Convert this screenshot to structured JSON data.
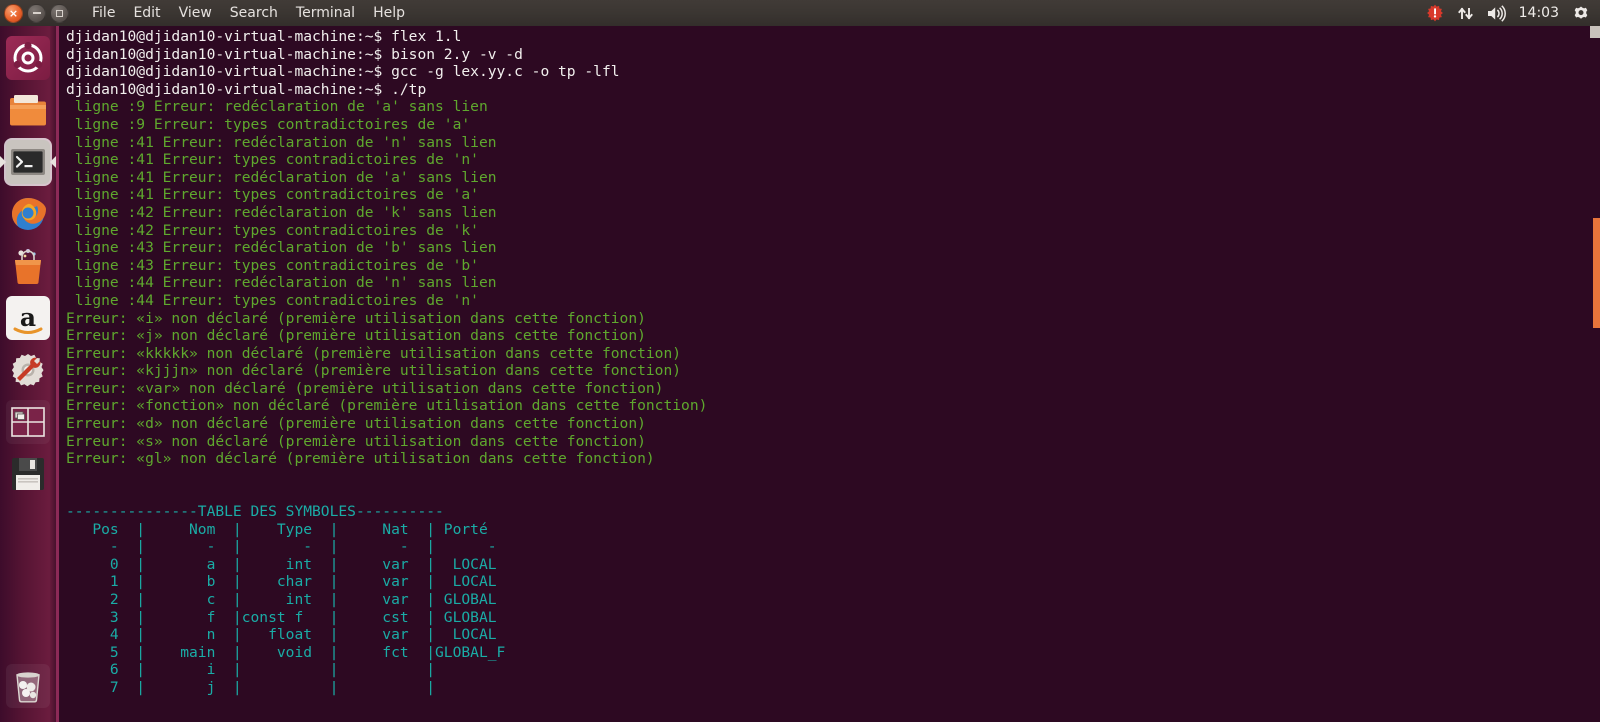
{
  "window": {
    "buttons": {
      "close": "×",
      "minimize": "−",
      "maximize": "□"
    },
    "menus": [
      "File",
      "Edit",
      "View",
      "Search",
      "Terminal",
      "Help"
    ]
  },
  "tray": {
    "icons": [
      "update-alert-icon",
      "network-icon",
      "volume-icon",
      "system-menu-icon"
    ],
    "clock": "14:03"
  },
  "launcher": {
    "items": [
      {
        "name": "ubuntu-dash",
        "label": "Dash home",
        "active": false
      },
      {
        "name": "files",
        "label": "Files",
        "active": false
      },
      {
        "name": "terminal",
        "label": "Terminal",
        "active": true
      },
      {
        "name": "firefox",
        "label": "Firefox Web Browser",
        "active": false
      },
      {
        "name": "software-center",
        "label": "Ubuntu Software Center",
        "active": false
      },
      {
        "name": "amazon",
        "label": "Amazon",
        "active": false
      },
      {
        "name": "system-settings",
        "label": "System Settings",
        "active": false
      },
      {
        "name": "workspace-switcher",
        "label": "Workspace Switcher",
        "active": false
      },
      {
        "name": "save-disk",
        "label": "Files & Devices",
        "active": false
      }
    ],
    "trash": {
      "name": "trash",
      "label": "Trash"
    }
  },
  "terminal": {
    "colors": {
      "background": "#2D0922",
      "prompt": "#F2F0EE",
      "error": "#5FA82E",
      "table": "#1AACA6",
      "border": "#8C2A57",
      "scrollbar": "#E8743B"
    },
    "prompt_user": "djidan10@djidan10-virtual-machine:~$",
    "lines": [
      {
        "style": "prompt",
        "text": "djidan10@djidan10-virtual-machine:~$ flex 1.l"
      },
      {
        "style": "prompt",
        "text": "djidan10@djidan10-virtual-machine:~$ bison 2.y -v -d"
      },
      {
        "style": "prompt",
        "text": "djidan10@djidan10-virtual-machine:~$ gcc -g lex.yy.c -o tp -lfl"
      },
      {
        "style": "prompt",
        "text": "djidan10@djidan10-virtual-machine:~$ ./tp"
      },
      {
        "style": "green",
        "text": " ligne :9 Erreur: redéclaration de 'a' sans lien"
      },
      {
        "style": "green",
        "text": " ligne :9 Erreur: types contradictoires de 'a'"
      },
      {
        "style": "green",
        "text": " ligne :41 Erreur: redéclaration de 'n' sans lien"
      },
      {
        "style": "green",
        "text": " ligne :41 Erreur: types contradictoires de 'n'"
      },
      {
        "style": "green",
        "text": " ligne :41 Erreur: redéclaration de 'a' sans lien"
      },
      {
        "style": "green",
        "text": " ligne :41 Erreur: types contradictoires de 'a'"
      },
      {
        "style": "green",
        "text": " ligne :42 Erreur: redéclaration de 'k' sans lien"
      },
      {
        "style": "green",
        "text": " ligne :42 Erreur: types contradictoires de 'k'"
      },
      {
        "style": "green",
        "text": " ligne :43 Erreur: redéclaration de 'b' sans lien"
      },
      {
        "style": "green",
        "text": " ligne :43 Erreur: types contradictoires de 'b'"
      },
      {
        "style": "green",
        "text": " ligne :44 Erreur: redéclaration de 'n' sans lien"
      },
      {
        "style": "green",
        "text": " ligne :44 Erreur: types contradictoires de 'n'"
      },
      {
        "style": "green",
        "text": "Erreur: «i» non déclaré (première utilisation dans cette fonction)"
      },
      {
        "style": "green",
        "text": "Erreur: «j» non déclaré (première utilisation dans cette fonction)"
      },
      {
        "style": "green",
        "text": "Erreur: «kkkkk» non déclaré (première utilisation dans cette fonction)"
      },
      {
        "style": "green",
        "text": "Erreur: «kjjjn» non déclaré (première utilisation dans cette fonction)"
      },
      {
        "style": "green",
        "text": "Erreur: «var» non déclaré (première utilisation dans cette fonction)"
      },
      {
        "style": "green",
        "text": "Erreur: «fonction» non déclaré (première utilisation dans cette fonction)"
      },
      {
        "style": "green",
        "text": "Erreur: «d» non déclaré (première utilisation dans cette fonction)"
      },
      {
        "style": "green",
        "text": "Erreur: «s» non déclaré (première utilisation dans cette fonction)"
      },
      {
        "style": "green",
        "text": "Erreur: «gl» non déclaré (première utilisation dans cette fonction)"
      },
      {
        "style": "blank",
        "text": " "
      },
      {
        "style": "blank",
        "text": " "
      },
      {
        "style": "cyan",
        "text": "---------------TABLE DES SYMBOLES----------"
      },
      {
        "style": "cyan",
        "text": "   Pos  |     Nom  |    Type  |     Nat  | Porté"
      },
      {
        "style": "cyan",
        "text": "     -  |       -  |       -  |       -  |      -"
      },
      {
        "style": "cyan",
        "text": "     0  |       a  |     int  |     var  |  LOCAL"
      },
      {
        "style": "cyan",
        "text": "     1  |       b  |    char  |     var  |  LOCAL"
      },
      {
        "style": "cyan",
        "text": "     2  |       c  |     int  |     var  | GLOBAL"
      },
      {
        "style": "cyan",
        "text": "     3  |       f  |const f   |     cst  | GLOBAL"
      },
      {
        "style": "cyan",
        "text": "     4  |       n  |   float  |     var  |  LOCAL"
      },
      {
        "style": "cyan",
        "text": "     5  |    main  |    void  |     fct  |GLOBAL_F"
      },
      {
        "style": "cyan",
        "text": "     6  |       i  |          |          |"
      },
      {
        "style": "cyan",
        "text": "     7  |       j  |          |          |"
      }
    ],
    "symbol_table": {
      "title": "TABLE DES SYMBOLES",
      "columns": [
        "Pos",
        "Nom",
        "Type",
        "Nat",
        "Porté"
      ],
      "rows": [
        [
          "-",
          "-",
          "-",
          "-",
          "-"
        ],
        [
          "0",
          "a",
          "int",
          "var",
          "LOCAL"
        ],
        [
          "1",
          "b",
          "char",
          "var",
          "LOCAL"
        ],
        [
          "2",
          "c",
          "int",
          "var",
          "GLOBAL"
        ],
        [
          "3",
          "f",
          "const f",
          "cst",
          "GLOBAL"
        ],
        [
          "4",
          "n",
          "float",
          "var",
          "LOCAL"
        ],
        [
          "5",
          "main",
          "void",
          "fct",
          "GLOBAL_F"
        ],
        [
          "6",
          "i",
          "",
          "",
          ""
        ],
        [
          "7",
          "j",
          "",
          "",
          ""
        ]
      ]
    }
  }
}
